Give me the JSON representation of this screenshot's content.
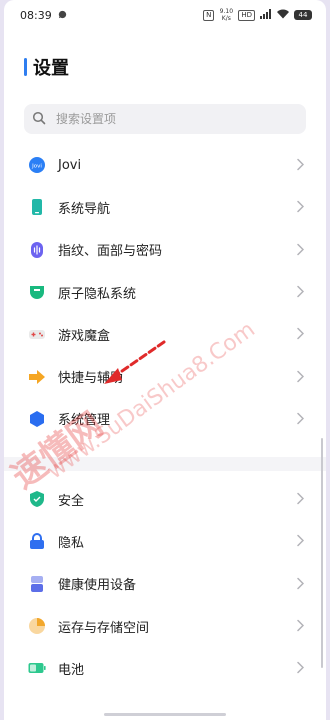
{
  "status": {
    "time": "08:39",
    "net_speed": "9.10 K/s",
    "battery": "44"
  },
  "header": {
    "title": "设置"
  },
  "search": {
    "placeholder": "搜索设置项"
  },
  "group1": [
    {
      "label": "Jovi",
      "icon": "jovi-icon",
      "color": "#2b7ff5"
    },
    {
      "label": "系统导航",
      "icon": "phone-nav-icon",
      "color": "#22b8a8"
    },
    {
      "label": "指纹、面部与密码",
      "icon": "fingerprint-icon",
      "color": "#6c63f0"
    },
    {
      "label": "原子隐私系统",
      "icon": "shield-privacy-icon",
      "color": "#19b97f"
    },
    {
      "label": "游戏魔盒",
      "icon": "gamepad-icon",
      "color": "#e04a4a"
    },
    {
      "label": "快捷与辅助",
      "icon": "shortcut-arrow-icon",
      "color": "#f5a623"
    },
    {
      "label": "系统管理",
      "icon": "hexagon-system-icon",
      "color": "#2a6df0"
    }
  ],
  "group2": [
    {
      "label": "安全",
      "icon": "shield-security-icon",
      "color": "#1fb88a"
    },
    {
      "label": "隐私",
      "icon": "lock-icon",
      "color": "#2f6ff0"
    },
    {
      "label": "健康使用设备",
      "icon": "health-device-icon",
      "color": "#5c6ee8"
    },
    {
      "label": "运存与存储空间",
      "icon": "storage-pie-icon",
      "color": "#f2a72b"
    },
    {
      "label": "电池",
      "icon": "battery-icon",
      "color": "#2dc88e"
    }
  ],
  "watermark": {
    "text": "速懂网",
    "url_text": "www.SuDaiShua8.Com"
  }
}
